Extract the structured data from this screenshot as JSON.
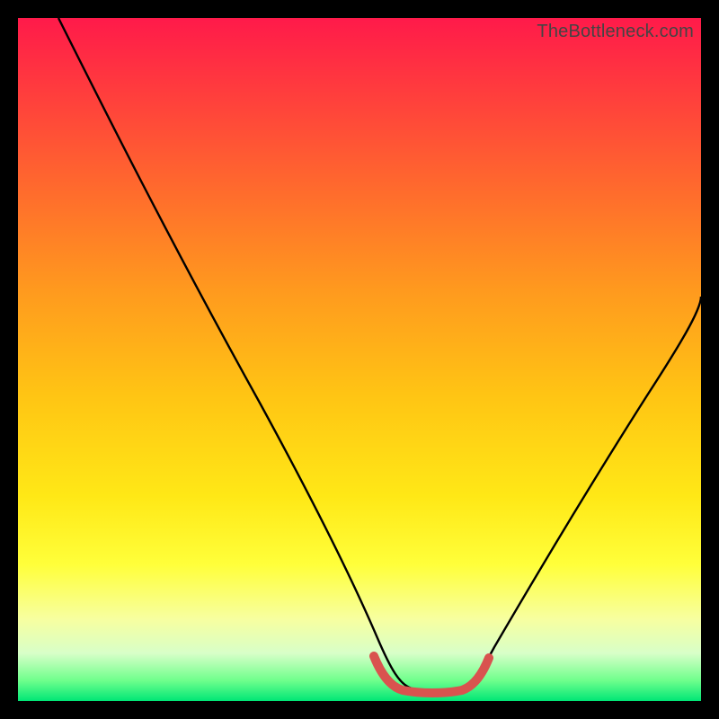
{
  "watermark": "TheBottleneck.com",
  "chart_data": {
    "type": "line",
    "title": "",
    "xlabel": "",
    "ylabel": "",
    "xlim": [
      0,
      100
    ],
    "ylim": [
      0,
      100
    ],
    "grid": false,
    "legend": false,
    "background_gradient_stops": [
      {
        "pos": 0,
        "color": "#ff1a4a"
      },
      {
        "pos": 10,
        "color": "#ff3a3e"
      },
      {
        "pos": 25,
        "color": "#ff6a2d"
      },
      {
        "pos": 40,
        "color": "#ff9a1e"
      },
      {
        "pos": 55,
        "color": "#ffc414"
      },
      {
        "pos": 70,
        "color": "#ffe816"
      },
      {
        "pos": 80,
        "color": "#ffff3a"
      },
      {
        "pos": 88,
        "color": "#f7ffa0"
      },
      {
        "pos": 93,
        "color": "#d8ffc8"
      },
      {
        "pos": 97,
        "color": "#6fff8c"
      },
      {
        "pos": 100,
        "color": "#00e676"
      }
    ],
    "series": [
      {
        "name": "bottleneck-curve",
        "color": "#000000",
        "x": [
          6,
          10,
          15,
          20,
          25,
          30,
          35,
          40,
          45,
          50,
          53,
          55,
          58,
          60,
          63,
          65,
          68,
          72,
          78,
          85,
          92,
          100
        ],
        "y": [
          100,
          92,
          82,
          72,
          62,
          52,
          43,
          34,
          25,
          15,
          9,
          5,
          2,
          2,
          2,
          3,
          7,
          14,
          24,
          36,
          47,
          59
        ]
      },
      {
        "name": "optimal-band",
        "color": "#d9534f",
        "stroke_width": 8,
        "x": [
          51,
          53,
          55,
          58,
          60,
          63,
          65,
          67
        ],
        "y": [
          7,
          3,
          2,
          2,
          2,
          2,
          3,
          6
        ]
      }
    ],
    "annotations": []
  }
}
